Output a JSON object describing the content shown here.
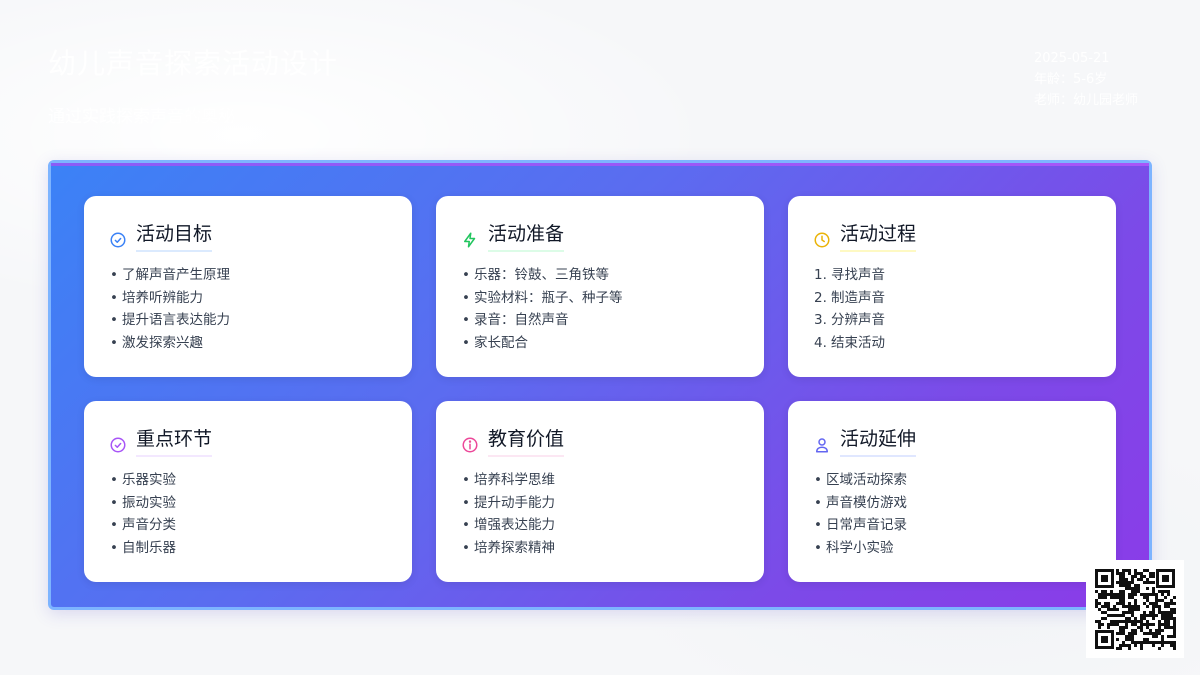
{
  "header": {
    "title": "幼儿声音探索活动设计",
    "subtitle": "通过实践探索声音的奥秘",
    "date": "2025-05-21",
    "age_line": "年龄：5-6岁",
    "teacher_line": "老师：幼儿园老师"
  },
  "colors": {
    "panel_start": "#3b82f6",
    "panel_end": "#8b3be8",
    "goal": "#3b82f6",
    "prep": "#22c55e",
    "process": "#eab308",
    "key": "#a855f7",
    "value": "#ec4899",
    "extend": "#6366f1"
  },
  "cards": [
    {
      "title": "活动目标",
      "icon": "check-circle-icon",
      "items": [
        "了解声音产生原理",
        "培养听辨能力",
        "提升语言表达能力",
        "激发探索兴趣"
      ]
    },
    {
      "title": "活动准备",
      "icon": "lightning-icon",
      "items": [
        "乐器：铃鼓、三角铁等",
        "实验材料：瓶子、种子等",
        "录音：自然声音",
        "家长配合"
      ]
    },
    {
      "title": "活动过程",
      "icon": "clock-icon",
      "items": [
        "寻找声音",
        "制造声音",
        "分辨声音",
        "结束活动"
      ],
      "numbers": [
        "1.",
        "2.",
        "3.",
        "4."
      ]
    },
    {
      "title": "重点环节",
      "icon": "check-badge-icon",
      "items": [
        "乐器实验",
        "振动实验",
        "声音分类",
        "自制乐器"
      ]
    },
    {
      "title": "教育价值",
      "icon": "info-icon",
      "items": [
        "培养科学思维",
        "提升动手能力",
        "增强表达能力",
        "培养探索精神"
      ]
    },
    {
      "title": "活动延伸",
      "icon": "user-icon",
      "items": [
        "区域活动探索",
        "声音模仿游戏",
        "日常声音记录",
        "科学小实验"
      ]
    }
  ],
  "qr": {
    "icon": "qr-code-icon"
  }
}
